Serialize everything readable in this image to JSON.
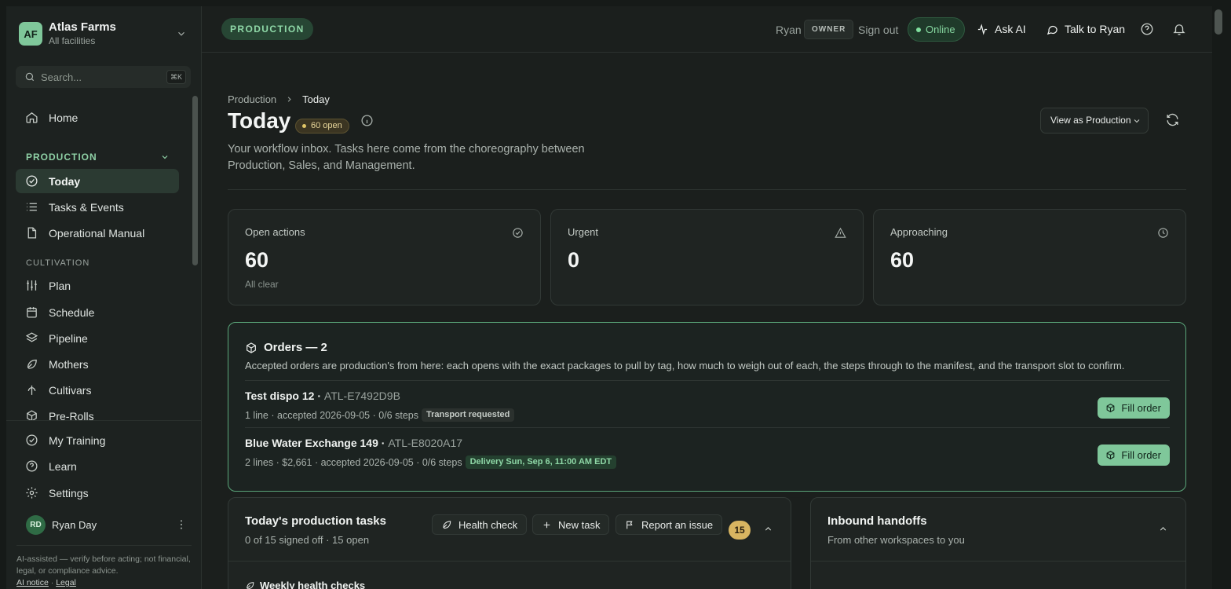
{
  "org": {
    "initials": "AF",
    "name": "Atlas Farms",
    "sub": "All facilities"
  },
  "search": {
    "placeholder": "Search...",
    "shortcut": "⌘K"
  },
  "sidebar": {
    "home": "Home",
    "production_header": "PRODUCTION",
    "production_items": [
      "Today",
      "Tasks & Events",
      "Operational Manual"
    ],
    "cultivation_header": "CULTIVATION",
    "cultivation_items": [
      "Plan",
      "Schedule",
      "Pipeline",
      "Mothers",
      "Cultivars",
      "Pre-Rolls"
    ],
    "bottom_items": [
      "My Training",
      "Learn",
      "Settings"
    ],
    "user": {
      "initials": "RD",
      "name": "Ryan Day"
    },
    "disclaimer": "AI-assisted — verify before acting; not financial, legal, or compliance advice.",
    "ai_notice": "AI notice",
    "sep": "·",
    "legal": "Legal"
  },
  "topbar": {
    "workspace": "PRODUCTION",
    "user": "Ryan",
    "role": "OWNER",
    "sign_out": "Sign out",
    "status": "Online",
    "ask_ai": "Ask AI",
    "talk": "Talk to Ryan"
  },
  "page": {
    "breadcrumb": [
      "Production",
      "Today"
    ],
    "title": "Today",
    "open_badge": "60 open",
    "subtitle": "Your workflow inbox. Tasks here come from the choreography between Production, Sales, and Management.",
    "view_as": "View as Production"
  },
  "stats": [
    {
      "label": "Open actions",
      "value": "60",
      "note": "All clear",
      "icon": "check-circle-icon"
    },
    {
      "label": "Urgent",
      "value": "0",
      "note": "",
      "icon": "warning-icon"
    },
    {
      "label": "Approaching",
      "value": "60",
      "note": "",
      "icon": "clock-icon"
    }
  ],
  "orders": {
    "title": "Orders — 2",
    "desc": "Accepted orders are production's from here: each opens with the exact packages to pull by tag, how much to weigh out of each, the steps through to the manifest, and the transport slot to confirm.",
    "button": "Fill order",
    "items": [
      {
        "name": "Test dispo 12",
        "code": "ATL-E7492D9B",
        "meta": "1 line · accepted 2026-09-05 · 0/6 steps",
        "tag": "Transport requested"
      },
      {
        "name": "Blue Water Exchange 149",
        "code": "ATL-E8020A17",
        "meta": "2 lines · $2,661 · accepted 2026-09-05 · 0/6 steps",
        "tag": "Delivery Sun, Sep 6, 11:00 AM EDT"
      }
    ]
  },
  "tasks_panel": {
    "title": "Today's production tasks",
    "sub": "0 of 15 signed off · 15 open",
    "health_check": "Health check",
    "new_task": "New task",
    "report": "Report an issue",
    "count": "15",
    "section": "Weekly health checks"
  },
  "handoffs_panel": {
    "title": "Inbound handoffs",
    "sub": "From other workspaces to you"
  },
  "colors": {
    "accent": "#7fc79a",
    "badge": "#d8b561",
    "border_green": "#5aa579"
  }
}
